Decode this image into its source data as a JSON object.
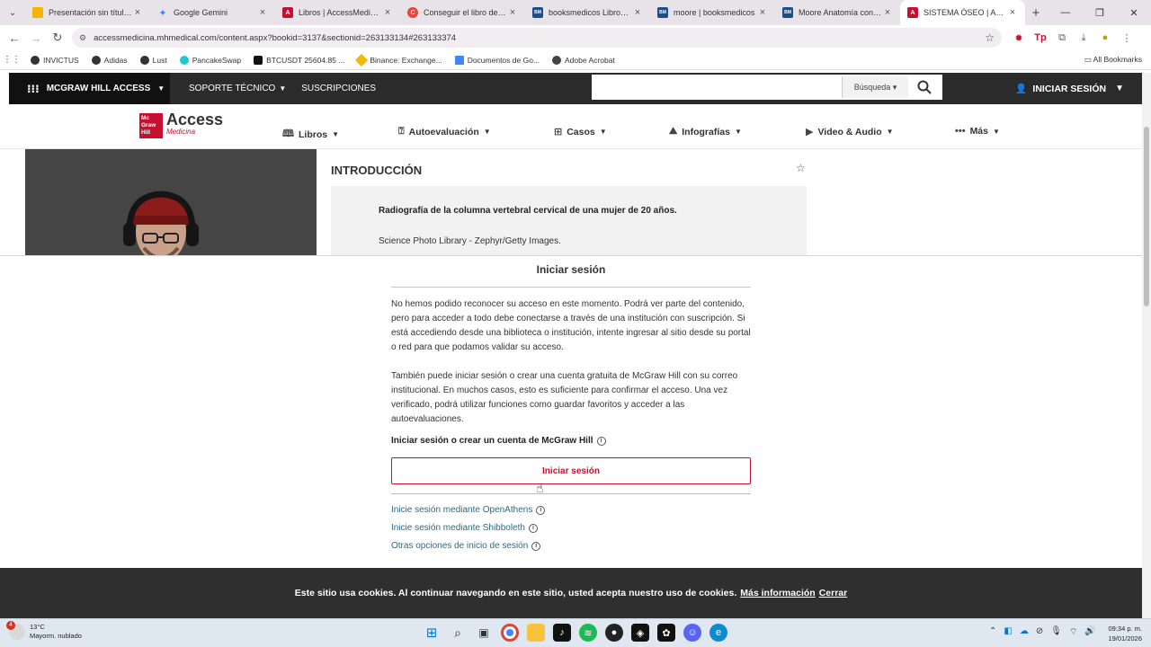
{
  "browser": {
    "tabs": [
      {
        "title": "Presentación sin título - Google Slides",
        "color": "#f4b400",
        "glyph": ""
      },
      {
        "title": "Google Gemini",
        "color": "#4285f4",
        "glyph": "✦"
      },
      {
        "title": "Libros | AccessMedicina | McGraw Hill",
        "color": "#c8102e",
        "glyph": "A"
      },
      {
        "title": "Conseguir el libro de Moore",
        "color": "#e8453c",
        "glyph": "C"
      },
      {
        "title": "booksmedicos Libros de Medicina",
        "color": "#1a4f8b",
        "glyph": "BM"
      },
      {
        "title": "moore | booksmedicos",
        "color": "#1a4f8b",
        "glyph": "BM"
      },
      {
        "title": "Moore Anatomía con Orientación Clínica",
        "color": "#1a4f8b",
        "glyph": "BM"
      },
      {
        "title": "SISTEMA ÓSEO | Anatomía",
        "color": "#c8102e",
        "glyph": "A"
      }
    ],
    "url": "accessmedicina.mhmedical.com/content.aspx?bookid=3137&sectionid=263133134#263133374",
    "bookmarks": [
      {
        "label": "INVICTUS",
        "color": "#333"
      },
      {
        "label": "Adidas",
        "color": "#333"
      },
      {
        "label": "Lust",
        "color": "#333"
      },
      {
        "label": "PancakeSwap",
        "color": "#1fc7d4"
      },
      {
        "label": "BTCUSDT 25604.85 ...",
        "color": "#111"
      },
      {
        "label": "Binance: Exchange...",
        "color": "#f0b90b"
      },
      {
        "label": "Documentos de Go...",
        "color": "#4285f4"
      },
      {
        "label": "Adobe Acrobat",
        "color": "#444"
      }
    ],
    "all_bookmarks": "All Bookmarks"
  },
  "site_header": {
    "brand_menu": "MCGRAW HILL ACCESS",
    "support": "SOPORTE TÉCNICO",
    "subscriptions": "SUSCRIPCIONES",
    "search_placeholder": "",
    "search_scope": "Búsqueda",
    "signin": "INICIAR SESIÓN"
  },
  "site_nav": {
    "logo_mc": "Mc Graw Hill",
    "logo_access": "Access",
    "logo_medicina": "Medicina",
    "items": [
      {
        "label": "Libros",
        "icon": "book-icon"
      },
      {
        "label": "Autoevaluación",
        "icon": "quiz-icon"
      },
      {
        "label": "Casos",
        "icon": "clipboard-icon"
      },
      {
        "label": "Infografías",
        "icon": "image-icon"
      },
      {
        "label": "Video & Audio",
        "icon": "play-icon"
      },
      {
        "label": "Más",
        "icon": "more-icon"
      }
    ]
  },
  "article": {
    "section_title": "INTRODUCCIÓN",
    "figure_caption": "Radiografía de la columna vertebral cervical de una mujer de 20 años.",
    "figure_credit": "Science Photo Library - Zephyr/Getty Images."
  },
  "login": {
    "title": "Iniciar sesión",
    "paragraph1": "No hemos podido reconocer su acceso en este momento. Podrá ver parte del contenido, pero para acceder a todo debe conectarse a través de una institución con suscripción. Si está accediendo desde una biblioteca o institución, intente ingresar al sitio desde su portal o red para que podamos validar su acceso.",
    "paragraph2": "También puede iniciar sesión o crear una cuenta gratuita de McGraw Hill con su correo institucional. En muchos casos, esto es suficiente para confirmar el acceso. Una vez verificado, podrá utilizar funciones como guardar favoritos y acceder a las autoevaluaciones.",
    "subheading": "Iniciar sesión o crear un cuenta de McGraw Hill",
    "button": "Iniciar sesión",
    "alt_links": [
      "Inicie sesión mediante OpenAthens",
      "Inicie sesión mediante Shibboleth",
      "Otras opciones de inicio de sesión"
    ]
  },
  "cookie_banner": {
    "text": "Este sitio usa cookies. Al continuar navegando en este sitio, usted acepta nuestro uso de cookies.",
    "more": "Más información",
    "close": "Cerrar"
  },
  "taskbar": {
    "temperature": "13°C",
    "weather": "Mayorm. nublado",
    "weather_badge": "4",
    "time": "09:34 p. m.",
    "date": "19/01/2026"
  },
  "colors": {
    "brand_red": "#c8102e",
    "header_dark": "#2b2b2b",
    "link_blue": "#2a6a8a",
    "cookie_bg": "#2f2f2f"
  }
}
